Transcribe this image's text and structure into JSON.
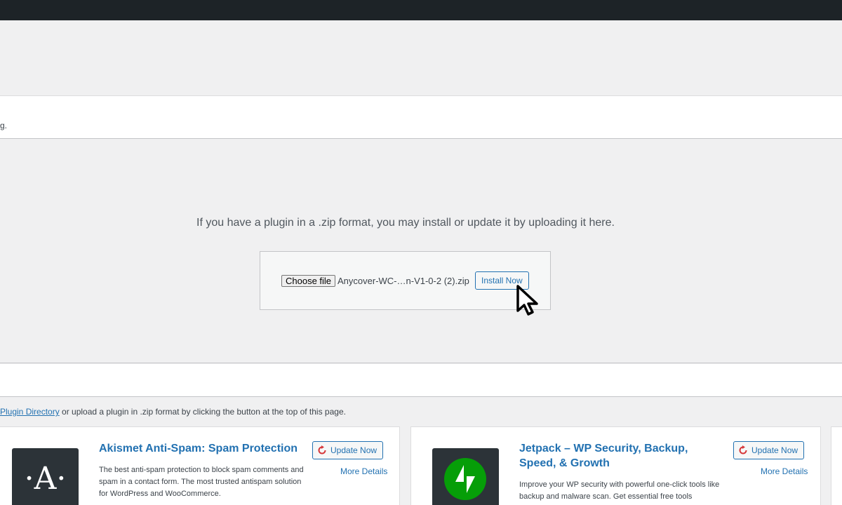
{
  "notice": {
    "fragment": "g."
  },
  "upload": {
    "help_text": "If you have a plugin in a .zip format, you may install or update it by uploading it here.",
    "choose_file_label": "Choose file",
    "file_name": "Anycover-WC-…n-V1-0-2 (2).zip",
    "install_label": "Install Now"
  },
  "directory": {
    "link_text": "Plugin Directory",
    "suffix_text": " or upload a plugin in .zip format by clicking the button at the top of this page."
  },
  "plugins": [
    {
      "title": "Akismet Anti-Spam: Spam Protection",
      "description": "The best anti-spam protection to block spam comments and spam in a contact form. The most trusted antispam solution for WordPress and WooCommerce.",
      "update_label": "Update Now",
      "more_label": "More Details",
      "icon_letter": "·A·"
    },
    {
      "title": "Jetpack – WP Security, Backup, Speed, & Growth",
      "description": "Improve your WP security with powerful one-click tools like backup and malware scan. Get essential free tools",
      "update_label": "Update Now",
      "more_label": "More Details"
    }
  ],
  "colors": {
    "accent": "#2271b1",
    "update_icon": "#d63638",
    "jetpack_green": "#069e08",
    "adminbar": "#1d2327"
  }
}
